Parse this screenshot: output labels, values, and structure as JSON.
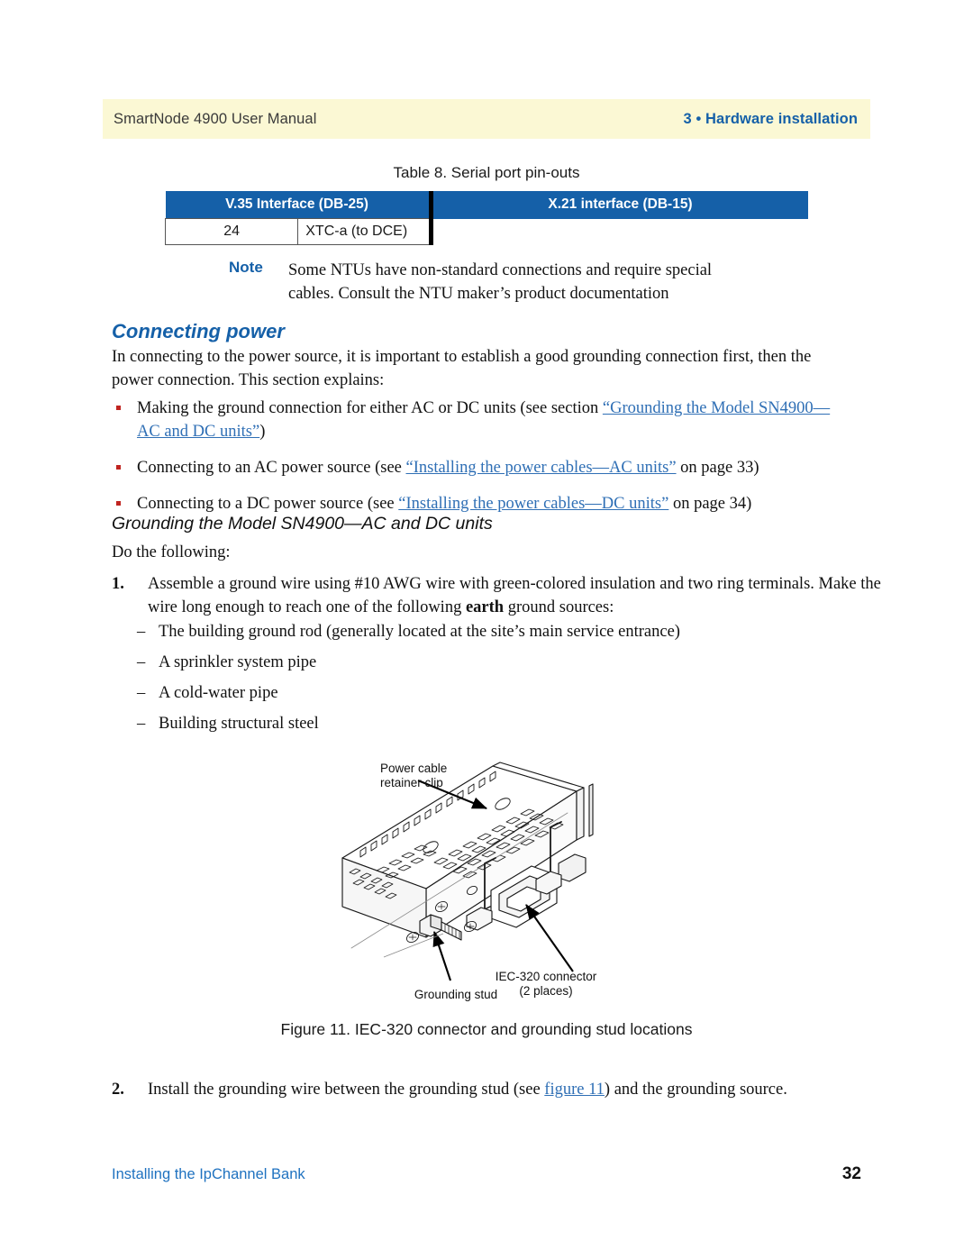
{
  "header": {
    "left": "SmartNode 4900 User Manual",
    "right": "3 • Hardware installation"
  },
  "table": {
    "caption": "Table 8. Serial port pin-outs",
    "columns": [
      "V.35 Interface (DB-25)",
      "X.21 interface (DB-15)"
    ],
    "rows": [
      {
        "pin": "24",
        "signal": "XTC-a (to DCE)",
        "x21": ""
      }
    ]
  },
  "note": {
    "label": "Note",
    "line1": "Some NTUs have non-standard connections and require special",
    "line2": "cables. Consult the NTU maker’s product documentation"
  },
  "headings": {
    "connecting_power": "Connecting power",
    "grounding_units": "Grounding the Model SN4900—AC and DC units"
  },
  "intro_paragraph": "In connecting to the power source, it is important to establish a good grounding connection first, then the power connection. This section explains:",
  "bullets": [
    {
      "pre": "Making the ground connection for either AC or DC units (see section ",
      "link": "“Grounding the Model SN4900—AC and DC units”",
      "post": ")"
    },
    {
      "pre": "Connecting to an AC power source (see ",
      "link": "“Installing the power cables—AC units”",
      "post": " on page 33)"
    },
    {
      "pre": "Connecting to a DC power source (see ",
      "link": "“Installing the power cables—DC units”",
      "post": " on page 34)"
    }
  ],
  "do_the_following": "Do the following:",
  "steps": [
    {
      "number": "1.",
      "pre": "Assemble a ground wire using #10 AWG wire with green-colored insulation and two ring terminals. Make the wire long enough to reach one of the following ",
      "bold": "earth",
      "post": " ground sources:"
    },
    {
      "number": "2.",
      "pre": "Install the grounding wire between the grounding stud (see ",
      "link": "figure 11",
      "post": ") and the grounding source."
    }
  ],
  "ground_sources": [
    "The building ground rod (generally located at the site’s main service entrance)",
    "A sprinkler system pipe",
    "A cold-water pipe",
    "Building structural steel"
  ],
  "figure": {
    "caption": "Figure 11. IEC-320 connector and grounding stud locations",
    "callouts": {
      "power_cable_line1": "Power cable",
      "power_cable_line2": "retainer clip",
      "grounding_stud": "Grounding stud",
      "iec_line1": "IEC-320 connector",
      "iec_line2": "(2 places)"
    }
  },
  "footer": {
    "left": "Installing the IpChannel Bank",
    "page": "32"
  },
  "colors": {
    "header_band": "#fbf8d4",
    "brand_blue": "#1560a8",
    "link_blue": "#2f6fb5",
    "bullet_red": "#c02420",
    "footer_blue": "#1f72c0"
  }
}
